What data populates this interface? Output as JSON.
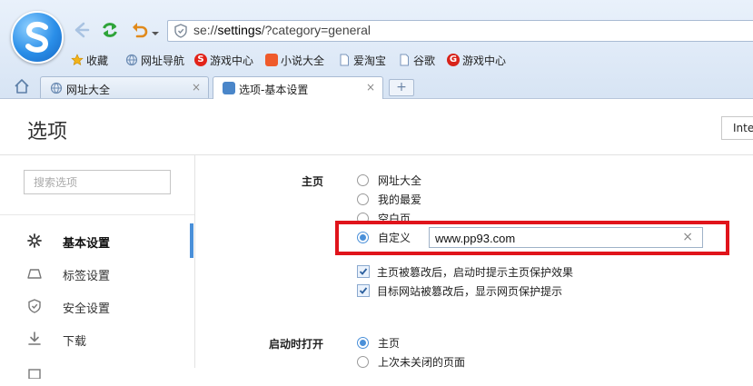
{
  "browser": {
    "address": {
      "prefix": "se://",
      "bold": "settings",
      "suffix": "/?category=general"
    },
    "bookmarks": [
      {
        "label": "收藏",
        "icon": "star-icon"
      },
      {
        "label": "网址导航",
        "icon": "globe-icon"
      },
      {
        "label": "游戏中心",
        "icon": "sogou-game-icon"
      },
      {
        "label": "小说大全",
        "icon": "novel-icon"
      },
      {
        "label": "爱淘宝",
        "icon": "page-icon"
      },
      {
        "label": "谷歌",
        "icon": "page-icon"
      },
      {
        "label": "游戏中心",
        "icon": "game-g-icon"
      }
    ],
    "tabs": [
      {
        "label": "网址大全",
        "close": "×"
      },
      {
        "label": "选项-基本设置",
        "close": "×"
      }
    ],
    "new_tab": "+"
  },
  "page": {
    "title": "选项",
    "language_box": "Inte",
    "search_placeholder": "搜索选项"
  },
  "sidebar": {
    "items": [
      {
        "label": "基本设置",
        "icon": "gear-icon",
        "active": true
      },
      {
        "label": "标签设置",
        "icon": "tab-icon",
        "active": false
      },
      {
        "label": "安全设置",
        "icon": "shield-icon",
        "active": false
      },
      {
        "label": "下载",
        "icon": "download-icon",
        "active": false
      }
    ]
  },
  "homepage": {
    "section_label": "主页",
    "options": [
      "网址大全",
      "我的最爱",
      "空白页",
      "自定义"
    ],
    "selected": "自定义",
    "custom_url": "www.pp93.com",
    "clear": "×",
    "checkboxes": [
      {
        "label": "主页被篡改后，启动时提示主页保护效果",
        "checked": true
      },
      {
        "label": "目标网站被篡改后，显示网页保护提示",
        "checked": true
      }
    ]
  },
  "startup": {
    "section_label": "启动时打开",
    "options": [
      "主页",
      "上次未关闭的页面"
    ],
    "selected": "主页"
  },
  "colors": {
    "accent": "#4a90d9",
    "highlight": "#e0141b"
  }
}
